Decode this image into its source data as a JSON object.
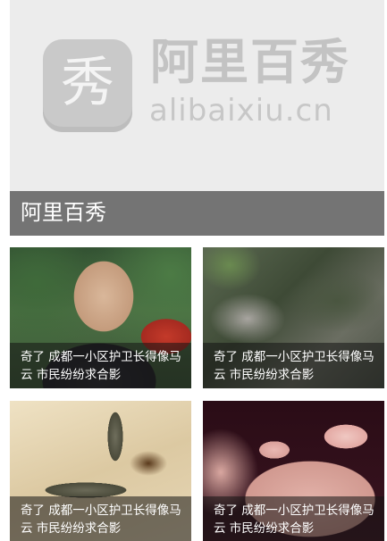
{
  "banner": {
    "emblem_char": "秀",
    "brand_cn": "阿里百秀",
    "brand_en": "alibaixiu.cn",
    "caption": "阿里百秀"
  },
  "cards": [
    {
      "title": "奇了 成都一小区护卫长得像马云 市民纷纷求合影"
    },
    {
      "title": "奇了 成都一小区护卫长得像马云 市民纷纷求合影"
    },
    {
      "title": "奇了 成都一小区护卫长得像马云 市民纷纷求合影"
    },
    {
      "title": "奇了 成都一小区护卫长得像马云 市民纷纷求合影"
    }
  ]
}
